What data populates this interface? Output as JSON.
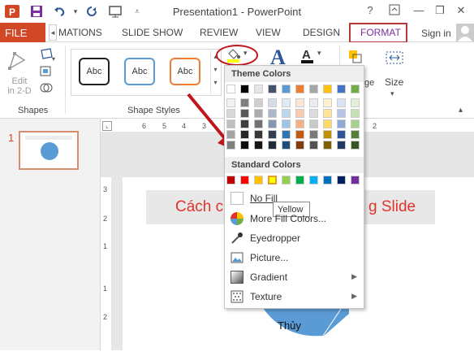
{
  "window": {
    "title": "Presentation1 - PowerPoint",
    "help": "?"
  },
  "tabs": {
    "file": "FILE",
    "animations": "MATIONS",
    "slide_show": "SLIDE SHOW",
    "review": "REVIEW",
    "view": "VIEW",
    "design": "DESIGN",
    "format": "FORMAT",
    "sign_in": "Sign in"
  },
  "ribbon": {
    "edit_label": "Edit in 2-D",
    "edit_line1": "Edit",
    "edit_line2": "in 2-D",
    "shapes_group": "Shapes",
    "shape_styles_group": "Shape Styles",
    "style_boxes": [
      "Abc",
      "Abc",
      "Abc"
    ],
    "size_label": "Size",
    "size_group_partial": "ge"
  },
  "slides": [
    {
      "number": "1"
    }
  ],
  "ruler_h": [
    "6",
    "5",
    "4",
    "3",
    "2"
  ],
  "ruler_v": [
    "3",
    "2",
    "1",
    "1",
    "2"
  ],
  "slide": {
    "title_left": "Cách c",
    "title_right": "g Slide",
    "shape_label": "Thủy"
  },
  "dropdown": {
    "theme_colors_header": "Theme Colors",
    "standard_colors_header": "Standard Colors",
    "no_fill": "No Fill",
    "more_fill_colors": "More Fill Colors...",
    "eyedropper": "Eyedropper",
    "picture": "Picture...",
    "gradient": "Gradient",
    "texture": "Texture",
    "tooltip": "Yellow"
  },
  "colors": {
    "accent": "#d24726",
    "format_tab": "#7b2e9e",
    "highlight_border": "#b33b3b",
    "arrow": "#c0161b",
    "slide_title_text": "#e0332a",
    "shape_fill": "#5b9bd5"
  }
}
